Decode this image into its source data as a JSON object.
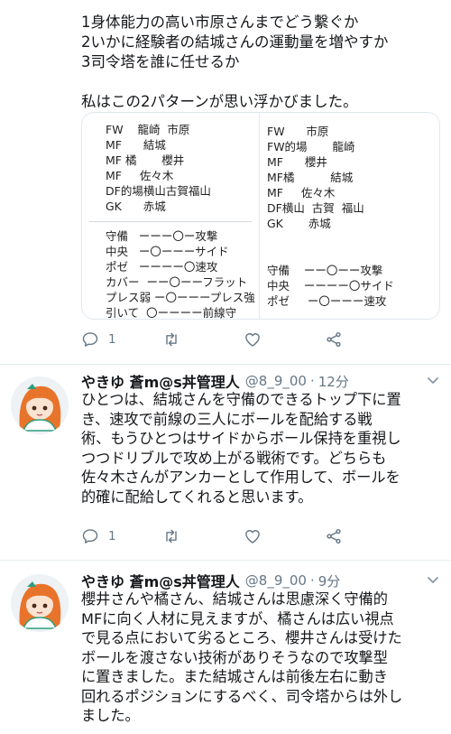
{
  "tweet1": {
    "lines": [
      "1身体能力の高い市原さんまでどう繋ぐか",
      "2いかに経験者の結城さんの運動量を増やすか",
      "3司令塔を誰に任せるか",
      "",
      "私はこの2パターンが思い浮かびました。"
    ],
    "image": {
      "left_formation": [
        "FW    龍崎  市原",
        "MF      結城",
        "MF 橘       櫻井",
        "MF     佐々木",
        "DF的場横山古賀福山",
        "GK      赤城"
      ],
      "left_scales": [
        "守備   ーーー〇ー攻撃",
        "中央   ー〇ーーーサイド",
        "ポゼ   ーーーー〇速攻",
        "カバー  ーー〇ーーフラット",
        "プレス弱 ー〇ーーープレス強",
        "引いて  〇ーーーー前線守"
      ],
      "right_formation": [
        "FW      市原",
        "FW的場       龍崎",
        "MF      櫻井",
        "MF橘          結城",
        "MF     佐々木",
        "DF横山  古賀  福山",
        "GK       赤城"
      ],
      "right_scales": [
        "守備    ーー〇ーー攻撃",
        "中央    ーーーー〇サイド",
        "ポゼ     ー〇ーーー速攻"
      ]
    },
    "actions": {
      "reply_count": "1",
      "retweet_count": "",
      "like_count": ""
    }
  },
  "tweet2": {
    "name": "やきゆ 蒼m@s丼管理人",
    "handle": "@8_9_00",
    "dot": "·",
    "time": "12分",
    "lines": [
      "ひとつは、結城さんを守備のできるトップ下に置",
      "き、速攻で前線の三人にボールを配給する戦",
      "術、もうひとつはサイドからボール保持を重視し",
      "つつドリブルで攻め上がる戦術です。どちらも",
      "佐々木さんがアンカーとして作用して、ボールを",
      "的確に配給してくれると思います。"
    ],
    "actions": {
      "reply_count": "1",
      "retweet_count": "",
      "like_count": ""
    }
  },
  "tweet3": {
    "name": "やきゆ 蒼m@s丼管理人",
    "handle": "@8_9_00",
    "dot": "·",
    "time": "9分",
    "lines": [
      "櫻井さんや橘さん、結城さんは思慮深く守備的",
      "MFに向く人材に見えますが、橘さんは広い視点",
      "で見る点において劣るところ、櫻井さんは受けた",
      "ボールを渡さない技術がありそうなので攻撃型",
      "に置きました。また結城さんは前後左右に動き",
      "回れるポジションにするべく、司令塔からは外し",
      "ました。"
    ]
  },
  "icons": {
    "reply": "reply-icon",
    "retweet": "retweet-icon",
    "like": "heart-icon",
    "share": "share-icon",
    "caret": "chevron-down-icon"
  },
  "colors": {
    "text": "#14171a",
    "secondary": "#657786",
    "border": "#e1e8ed",
    "avatar_hair": "#e8742b",
    "avatar_ribbon": "#2e9e7e"
  }
}
